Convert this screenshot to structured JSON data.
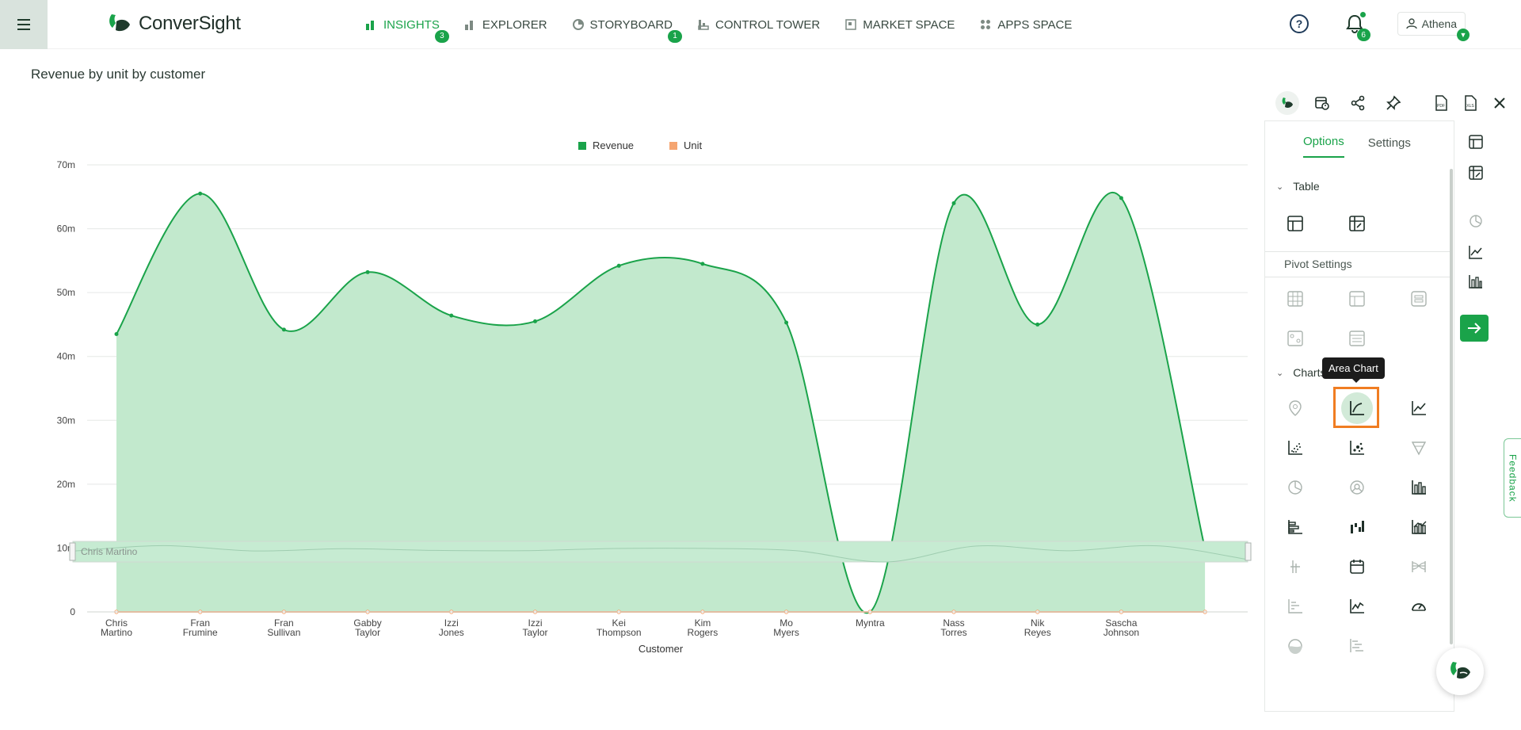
{
  "topbar": {
    "brand": "ConverSight",
    "nav": [
      {
        "label": "INSIGHTS",
        "badge": "3",
        "active": true,
        "icon": "bar-chart-icon"
      },
      {
        "label": "EXPLORER",
        "badge": "",
        "active": false,
        "icon": "explorer-bars-icon"
      },
      {
        "label": "STORYBOARD",
        "badge": "1",
        "active": false,
        "icon": "storyboard-pie-icon"
      },
      {
        "label": "CONTROL TOWER",
        "badge": "",
        "active": false,
        "icon": "control-tower-icon"
      },
      {
        "label": "MARKET SPACE",
        "badge": "",
        "active": false,
        "icon": "market-space-icon"
      },
      {
        "label": "APPS SPACE",
        "badge": "",
        "active": false,
        "icon": "apps-grid-icon"
      }
    ],
    "notifications_count": "6",
    "user_name": "Athena"
  },
  "page": {
    "title": "Revenue by unit by customer"
  },
  "chart_data": {
    "type": "area",
    "legend": [
      "Revenue",
      "Unit"
    ],
    "legend_position": "top-center",
    "xlabel": "Customer",
    "categories": [
      [
        "Chris",
        "Martino"
      ],
      [
        "Fran",
        "Frumine"
      ],
      [
        "Fran",
        "Sullivan"
      ],
      [
        "Gabby",
        "Taylor"
      ],
      [
        "Izzi",
        "Jones"
      ],
      [
        "Izzi",
        "Taylor"
      ],
      [
        "Kei",
        "Thompson"
      ],
      [
        "Kim",
        "Rogers"
      ],
      [
        "Mo",
        "Myers"
      ],
      [
        "Myntra"
      ],
      [
        "Nass",
        "Torres"
      ],
      [
        "Nik",
        "Reyes"
      ],
      [
        "Sascha",
        "Johnson"
      ],
      [
        ""
      ]
    ],
    "series": [
      {
        "name": "Revenue",
        "color": "#1aa34a",
        "fill": "#c2e9cd",
        "values": [
          43.5,
          65.5,
          44.2,
          53.2,
          46.4,
          45.5,
          54.2,
          54.5,
          45.3,
          0.0,
          64.0,
          45.0,
          64.8,
          9.9
        ]
      },
      {
        "name": "Unit",
        "color": "#f5a571",
        "values": [
          0,
          0,
          0,
          0,
          0,
          0,
          0,
          0,
          0,
          0,
          0,
          0,
          0,
          0
        ]
      }
    ],
    "yticks": [
      "0",
      "10m",
      "20m",
      "30m",
      "40m",
      "50m",
      "60m",
      "70m"
    ],
    "ylim": [
      0,
      70
    ],
    "grid": true,
    "zoom_slider_label": "Chris Martino"
  },
  "panel": {
    "tabs": [
      "Options",
      "Settings"
    ],
    "active_tab": "Options",
    "table_section": "Table",
    "pivot_section": "Pivot Settings",
    "chart_section": "Charts",
    "tooltip": "Area Chart",
    "feedback": "Feedback"
  }
}
